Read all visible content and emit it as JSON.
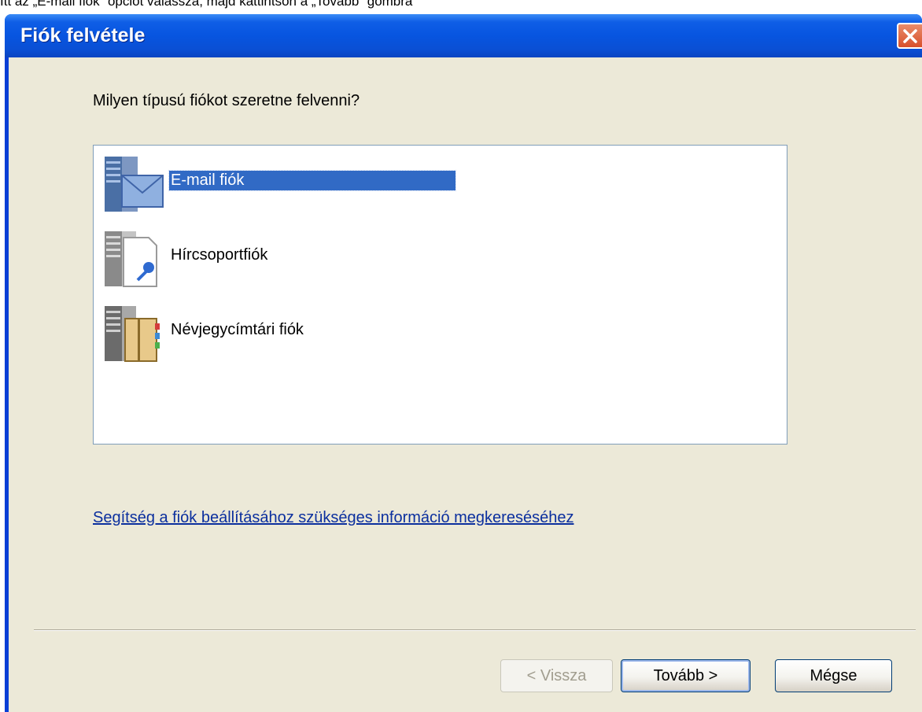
{
  "caption": "Itt az „E-mail fiók” opciót válassza, majd kattintson a „Tovább” gombra",
  "window": {
    "title": "Fiók felvétele"
  },
  "question": "Milyen típusú fiókot szeretne felvenni?",
  "account_types": [
    {
      "label": "E-mail fiók",
      "icon": "email-server-icon",
      "selected": true
    },
    {
      "label": "Hírcsoportfiók",
      "icon": "newsgroup-server-icon",
      "selected": false
    },
    {
      "label": "Névjegycímtári fiók",
      "icon": "directory-server-icon",
      "selected": false
    }
  ],
  "help_link": "Segítség a fiók beállításához szükséges információ megkereséséhez",
  "buttons": {
    "back": "< Vissza",
    "next": "Tovább >",
    "cancel": "Mégse"
  },
  "colors": {
    "titlebar": "#0755e0",
    "selection": "#316ac5",
    "dialog_bg": "#ece9d8",
    "link": "#0b2f9e"
  }
}
